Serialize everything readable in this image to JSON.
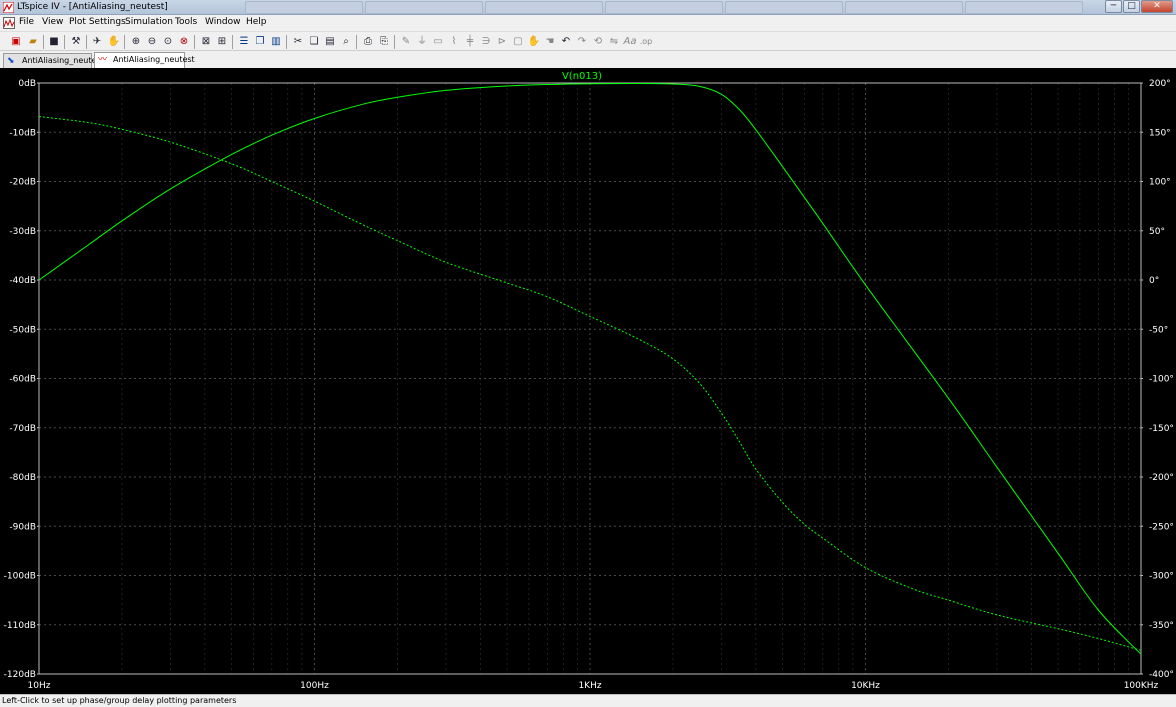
{
  "window": {
    "title": "LTspice IV - [AntiAliasing_neutest]",
    "controls": {
      "minimize": "─",
      "maximize": "□",
      "close": "✕"
    }
  },
  "menu": {
    "items": [
      "File",
      "View",
      "Plot Settings",
      "Simulation",
      "Tools",
      "Window",
      "Help"
    ],
    "mdi": {
      "minimize": "─",
      "restore": "❐",
      "close": "✕"
    }
  },
  "toolbar": {
    "icons": [
      "new-schematic-icon",
      "open-icon",
      "save-icon",
      "control-panel-icon",
      "run-icon",
      "halt-icon",
      "zoom-in-icon",
      "zoom-out-icon",
      "zoom-full-icon",
      "zoom-back-icon",
      "autorange-icon",
      "add-trace-icon",
      "tile-horizontal-icon",
      "cascade-icon",
      "tile-vertical-icon",
      "cut-icon",
      "copy-icon",
      "paste-icon",
      "find-icon",
      "print-setup-icon",
      "print-icon",
      "wire-icon",
      "ground-icon",
      "label-icon",
      "resistor-icon",
      "capacitor-icon",
      "inductor-icon",
      "diode-icon",
      "component-icon",
      "move-icon",
      "drag-icon",
      "undo-icon",
      "redo-icon",
      "rotate-icon",
      "mirror-icon",
      "text-icon",
      "spice-directive-icon"
    ]
  },
  "tabs": [
    {
      "label": "AntiAliasing_neutest",
      "kind": "schematic",
      "active": false
    },
    {
      "label": "AntiAliasing_neutest",
      "kind": "waveform",
      "active": true
    }
  ],
  "status": {
    "text": "Left-Click to set up phase/group delay plotting parameters"
  },
  "colors": {
    "background": "#000000",
    "trace": "#00ff00",
    "grid": "#4a4a4a",
    "axis_text": "#ffffff"
  },
  "chart_data": {
    "type": "line",
    "title": "V(n013)",
    "x_scale": "log",
    "x_range": [
      10,
      100000
    ],
    "x_ticks": [
      10,
      100,
      1000,
      10000,
      100000
    ],
    "x_tick_labels": [
      "10Hz",
      "100Hz",
      "1KHz",
      "10KHz",
      "100KHz"
    ],
    "y_left_range": [
      -120,
      0
    ],
    "y_left_ticks": [
      0,
      -10,
      -20,
      -30,
      -40,
      -50,
      -60,
      -70,
      -80,
      -90,
      -100,
      -110,
      -120
    ],
    "y_left_tick_labels": [
      "0dB",
      "-10dB",
      "-20dB",
      "-30dB",
      "-40dB",
      "-50dB",
      "-60dB",
      "-70dB",
      "-80dB",
      "-90dB",
      "-100dB",
      "-110dB",
      "-120dB"
    ],
    "y_right_range": [
      -400,
      200
    ],
    "y_right_ticks": [
      200,
      150,
      100,
      50,
      0,
      -50,
      -100,
      -150,
      -200,
      -250,
      -300,
      -350,
      -400
    ],
    "y_right_tick_labels": [
      "200°",
      "150°",
      "100°",
      "50°",
      "0°",
      "-50°",
      "-100°",
      "-150°",
      "-200°",
      "-250°",
      "-300°",
      "-350°",
      "-400°"
    ],
    "grid": true,
    "series": [
      {
        "name": "V(n013)",
        "quantity": "magnitude",
        "unit": "dB",
        "axis": "left",
        "style": "solid",
        "x": [
          10,
          15,
          20,
          30,
          50,
          70,
          100,
          150,
          200,
          300,
          500,
          700,
          1000,
          1500,
          2000,
          2500,
          3000,
          3500,
          4000,
          5000,
          7000,
          10000,
          20000,
          30000,
          50000,
          70000,
          100000
        ],
        "y": [
          -40,
          -33,
          -28,
          -21.5,
          -14.5,
          -10.6,
          -7.2,
          -4.3,
          -2.9,
          -1.5,
          -0.6,
          -0.3,
          -0.15,
          -0.1,
          -0.2,
          -0.7,
          -2.3,
          -5.5,
          -9.5,
          -17,
          -28.5,
          -41,
          -64,
          -78,
          -95.5,
          -107,
          -116
        ]
      },
      {
        "name": "V(n013)",
        "quantity": "phase",
        "unit": "°",
        "axis": "right",
        "style": "dashed",
        "x": [
          10,
          15,
          20,
          30,
          50,
          70,
          100,
          150,
          200,
          300,
          500,
          700,
          1000,
          1500,
          2000,
          2500,
          3000,
          3500,
          4000,
          5000,
          6000,
          7000,
          10000,
          15000,
          20000,
          30000,
          50000,
          70000,
          100000
        ],
        "y": [
          166,
          160,
          153,
          140,
          118,
          100,
          80,
          56,
          40,
          18,
          -3,
          -17,
          -37,
          -60,
          -80,
          -105,
          -135,
          -165,
          -192,
          -226,
          -248,
          -262,
          -292,
          -314,
          -325,
          -340,
          -354,
          -364,
          -376
        ]
      }
    ]
  }
}
